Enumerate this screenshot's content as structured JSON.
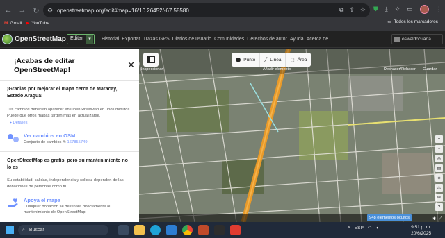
{
  "browser": {
    "url": "openstreetmap.org/edit#map=16/10.26452/-67.58580",
    "bookmarks": [
      {
        "label": "Gmail"
      },
      {
        "label": "YouTube"
      }
    ],
    "all_bookmarks_label": "Todos los marcadores"
  },
  "osm": {
    "title": "OpenStreetMap",
    "edit_button": "Editar",
    "nav": [
      "Historial",
      "Exportar",
      "Trazas GPS",
      "Diarios de usuario",
      "Comunidades",
      "Derechos de autor",
      "Ayuda",
      "Acerca de"
    ],
    "username": "oswaldocuarta"
  },
  "sidebar": {
    "title": "¡Acabas de editar OpenStreetMap!",
    "thanks_heading": "¡Gracias por mejorar el mapa cerca de Maracay, Estado Aragua!",
    "thanks_text": "Tus cambios deberían aparecer en OpenStreetMap en unos minutos. Puede que otros mapas tarden más en actualizarse.",
    "details_link": "Detalles",
    "view_changes_title": "Ver cambios en OSM",
    "changeset_label": "Conjunto de cambios #:",
    "changeset_id": "167855749",
    "free_heading": "OpenStreetMap es gratis, pero su mantenimiento no lo es",
    "free_text": "Su estabilidad, calidad, independencia y solidez dependen de las donaciones de personas como tú.",
    "support_title": "Apoya el mapa",
    "support_text": "Cualquier donación se destinará directamente al mantenimiento de OpenStreetMap."
  },
  "map": {
    "inspect_label": "Inspeccionar",
    "modes": [
      {
        "label": "Punto",
        "icon": "point-icon"
      },
      {
        "label": "Línea",
        "icon": "line-icon"
      },
      {
        "label": "Área",
        "icon": "area-icon"
      }
    ],
    "add_element_label": "Añadir elemento",
    "undo_label": "Deshacer/Rehacer",
    "save_label": "Guardar",
    "hidden_elements": "948 elementos ocultos"
  },
  "taskbar": {
    "search_placeholder": "Buscar",
    "lang": "ESP",
    "time": "9:51 p. m.",
    "date": "20/6/2025"
  }
}
